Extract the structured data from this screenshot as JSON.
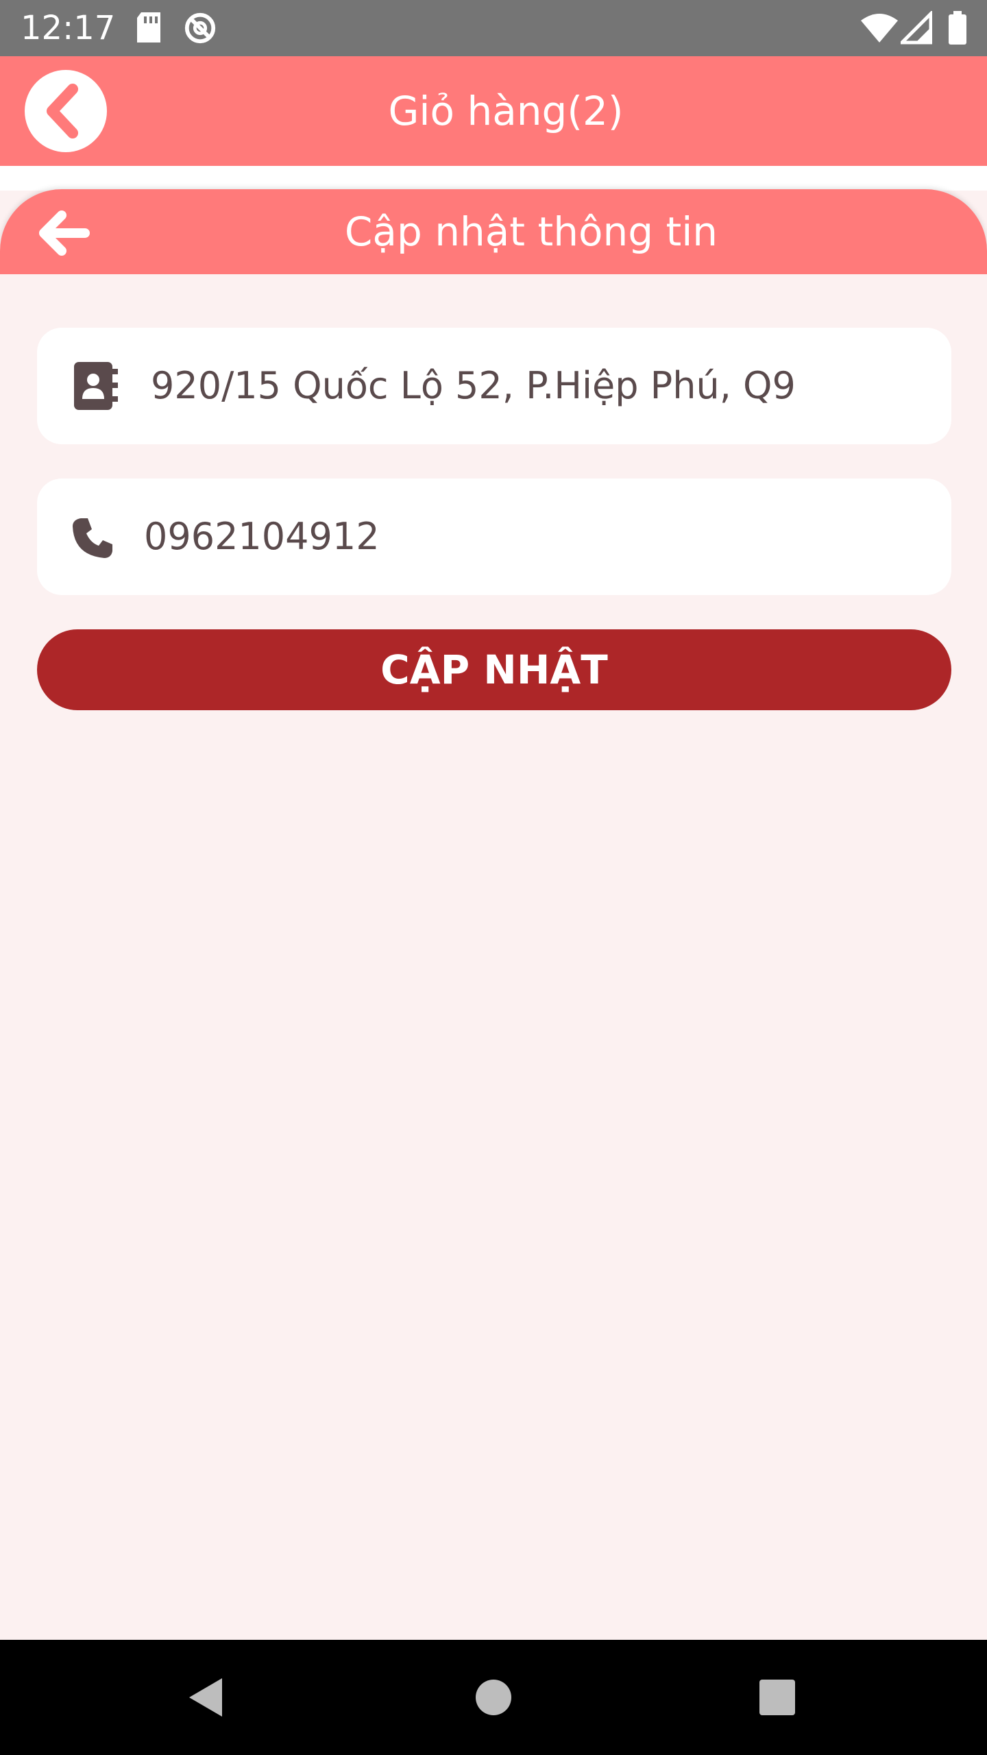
{
  "status_bar": {
    "time": "12:17",
    "icons": [
      "sd-card-icon",
      "data-saver-icon",
      "wifi-icon",
      "signal-icon",
      "battery-icon"
    ]
  },
  "app_bar": {
    "title": "Giỏ hàng(2)",
    "back_icon": "chevron-left-icon"
  },
  "sheet": {
    "title": "Cập nhật thông tin",
    "back_icon": "arrow-left-icon"
  },
  "form": {
    "address": {
      "value": "920/15 Quốc Lộ 52, P.Hiệp Phú, Q9",
      "icon": "address-book-icon"
    },
    "phone": {
      "value": "0962104912",
      "icon": "phone-icon"
    },
    "submit_label": "CẬP NHẬT"
  },
  "colors": {
    "header": "#ff7a7a",
    "button": "#ad2628",
    "background": "#fcf1f1",
    "status_bar": "#757575",
    "nav_bar": "#000000"
  },
  "nav_bar": {
    "buttons": [
      "back-triangle-icon",
      "home-circle-icon",
      "recents-square-icon"
    ]
  }
}
